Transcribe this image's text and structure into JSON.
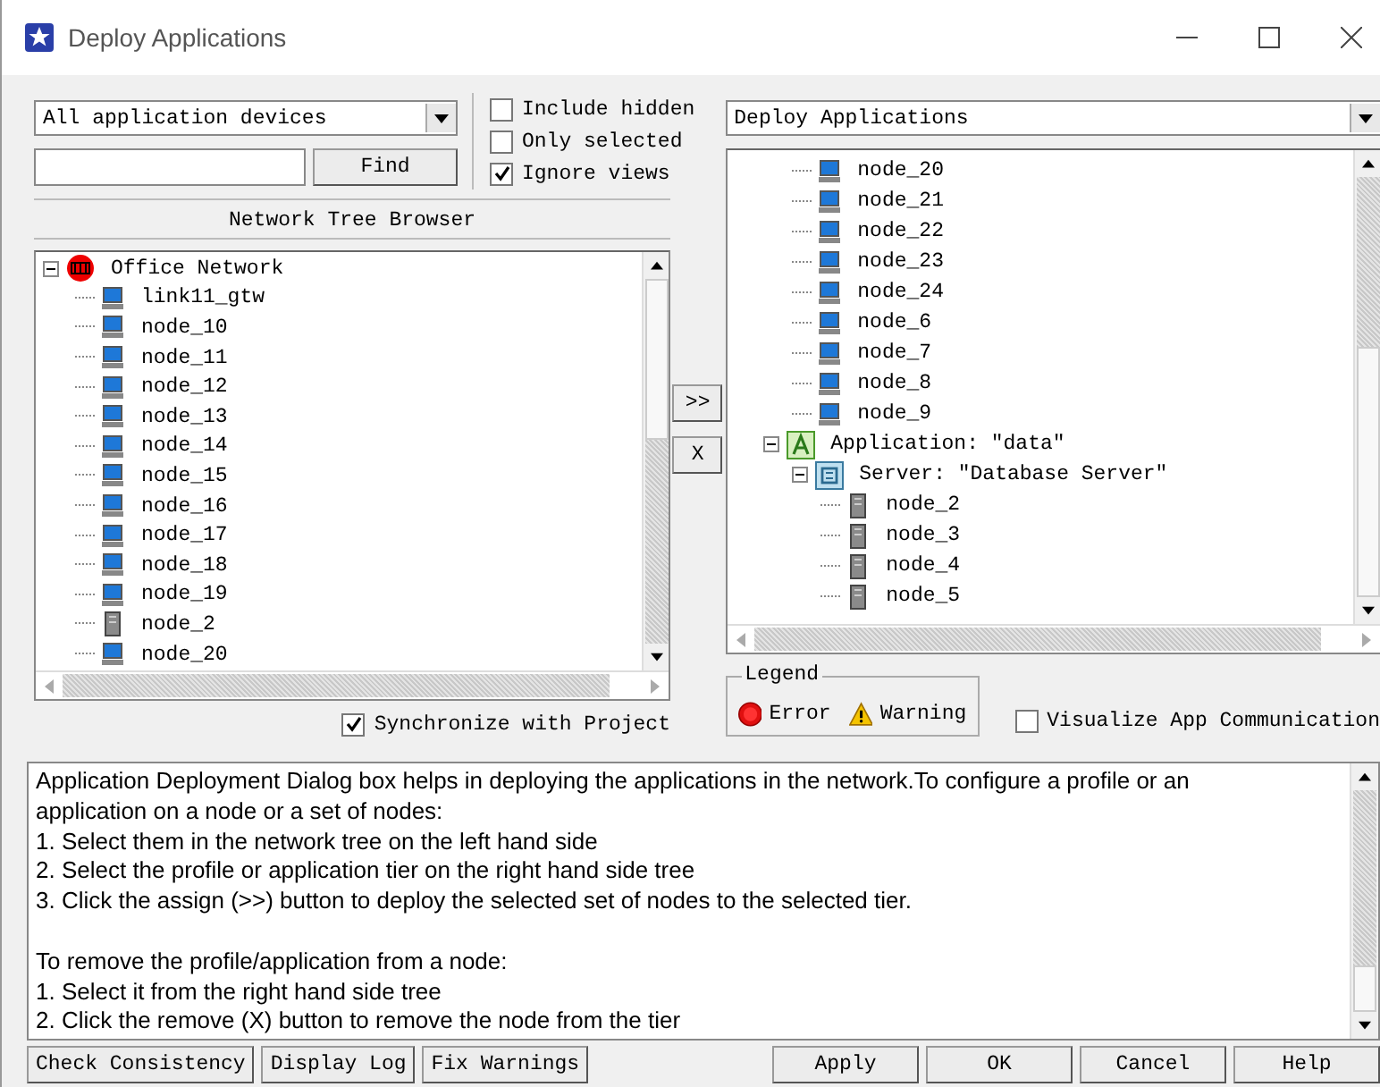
{
  "window": {
    "title": "Deploy Applications"
  },
  "filter": {
    "value": "All application devices"
  },
  "search": {
    "button": "Find"
  },
  "options": [
    {
      "label": "Include hidden",
      "checked": false
    },
    {
      "label": "Only selected",
      "checked": false
    },
    {
      "label": "Ignore views",
      "checked": true
    }
  ],
  "left_heading": "Network Tree Browser",
  "left_tree": {
    "items": [
      {
        "label": "Office Network",
        "kind": "network",
        "expanded": true,
        "children": [
          {
            "label": "link11_gtw",
            "kind": "gateway"
          },
          {
            "label": "node_10",
            "kind": "computer"
          },
          {
            "label": "node_11",
            "kind": "computer"
          },
          {
            "label": "node_12",
            "kind": "computer"
          },
          {
            "label": "node_13",
            "kind": "computer"
          },
          {
            "label": "node_14",
            "kind": "computer"
          },
          {
            "label": "node_15",
            "kind": "computer"
          },
          {
            "label": "node_16",
            "kind": "computer"
          },
          {
            "label": "node_17",
            "kind": "computer"
          },
          {
            "label": "node_18",
            "kind": "computer"
          },
          {
            "label": "node_19",
            "kind": "computer"
          },
          {
            "label": "node_2",
            "kind": "server"
          },
          {
            "label": "node_20",
            "kind": "computer"
          }
        ]
      }
    ]
  },
  "sync": {
    "label": "Synchronize with Project",
    "checked": true
  },
  "transfer_buttons": [
    ">>",
    "X"
  ],
  "deploy_select": {
    "value": "Deploy Applications"
  },
  "right_tree": {
    "items": [
      {
        "children": [
          {
            "label": "node_20",
            "kind": "computer"
          },
          {
            "label": "node_21",
            "kind": "computer"
          },
          {
            "label": "node_22",
            "kind": "computer"
          },
          {
            "label": "node_23",
            "kind": "computer"
          },
          {
            "label": "node_24",
            "kind": "computer"
          },
          {
            "label": "node_6",
            "kind": "computer"
          },
          {
            "label": "node_7",
            "kind": "computer"
          },
          {
            "label": "node_8",
            "kind": "computer"
          },
          {
            "label": "node_9",
            "kind": "computer"
          }
        ]
      },
      {
        "label": "Application: \"data\"",
        "kind": "application",
        "expanded": true,
        "children": [
          {
            "label": "Server: \"Database Server\"",
            "kind": "tier",
            "expanded": true,
            "children": [
              {
                "label": "node_2",
                "kind": "server"
              },
              {
                "label": "node_3",
                "kind": "server"
              },
              {
                "label": "node_4",
                "kind": "server"
              },
              {
                "label": "node_5",
                "kind": "server"
              }
            ]
          }
        ]
      }
    ]
  },
  "legend": {
    "title": "Legend",
    "items": [
      {
        "label": "Error",
        "kind": "error"
      },
      {
        "label": "Warning",
        "kind": "warning"
      }
    ]
  },
  "visualize": {
    "label": "Visualize App Communication",
    "checked": false
  },
  "help": {
    "paragraphs": [
      [
        "Application Deployment Dialog box helps in deploying the applications in the network.To configure a profile or an",
        "application on a node or a set of nodes:",
        "1. Select them in the network tree on the left hand side",
        "2. Select the profile or application tier on the right hand side tree",
        "3. Click the assign (>>) button to deploy the selected set of nodes to the selected tier."
      ],
      [
        "To remove the profile/application from a node:",
        "1. Select it from the right hand side tree",
        "2. Click the remove (X) button to remove the node from the tier"
      ]
    ]
  },
  "left_buttons": [
    "Check Consistency",
    "Display Log",
    "Fix Warnings"
  ],
  "right_buttons": [
    "Apply",
    "OK",
    "Cancel",
    "Help"
  ]
}
